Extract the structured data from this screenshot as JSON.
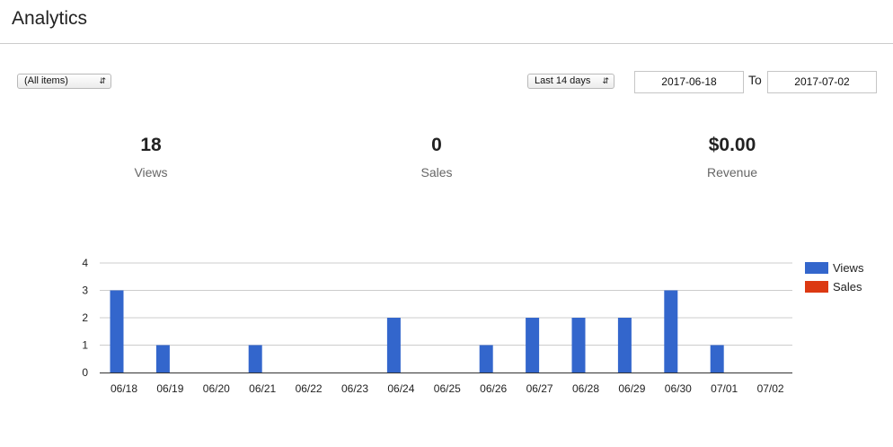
{
  "page": {
    "title": "Analytics"
  },
  "filters": {
    "item_select": "(All items)",
    "range_select": "Last 14 days",
    "date_from": "2017-06-18",
    "to_label": "To",
    "date_to": "2017-07-02"
  },
  "stats": [
    {
      "value": "18",
      "label": "Views"
    },
    {
      "value": "0",
      "label": "Sales"
    },
    {
      "value": "$0.00",
      "label": "Revenue"
    }
  ],
  "chart_data": {
    "type": "bar",
    "categories": [
      "06/18",
      "06/19",
      "06/20",
      "06/21",
      "06/22",
      "06/23",
      "06/24",
      "06/25",
      "06/26",
      "06/27",
      "06/28",
      "06/29",
      "06/30",
      "07/01",
      "07/02"
    ],
    "series": [
      {
        "name": "Views",
        "color": "#3366cc",
        "values": [
          3,
          1,
          0,
          1,
          0,
          0,
          2,
          0,
          1,
          2,
          2,
          2,
          3,
          1,
          0
        ]
      },
      {
        "name": "Sales",
        "color": "#dc3912",
        "values": [
          0,
          0,
          0,
          0,
          0,
          0,
          0,
          0,
          0,
          0,
          0,
          0,
          0,
          0,
          0
        ]
      }
    ],
    "ylim": [
      0,
      4
    ],
    "yticks": [
      "0",
      "1",
      "2",
      "3",
      "4"
    ],
    "grid": true,
    "legend": "right"
  }
}
